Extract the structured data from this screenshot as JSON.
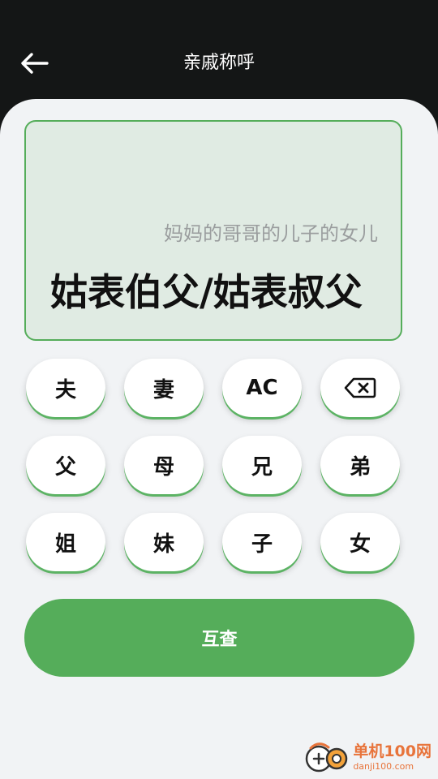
{
  "header": {
    "title": "亲戚称呼",
    "back_icon": "arrow-left-icon"
  },
  "display": {
    "expression": "妈妈的哥哥的儿子的女儿",
    "result": "姑表伯父/姑表叔父"
  },
  "keypad": {
    "rows": [
      [
        "夫",
        "妻",
        "AC",
        "backspace"
      ],
      [
        "父",
        "母",
        "兄",
        "弟"
      ],
      [
        "姐",
        "妹",
        "子",
        "女"
      ]
    ],
    "k_husband": "夫",
    "k_wife": "妻",
    "k_clear": "AC",
    "k_father": "父",
    "k_mother": "母",
    "k_elder_brother": "兄",
    "k_younger_brother": "弟",
    "k_elder_sister": "姐",
    "k_younger_sister": "妹",
    "k_son": "子",
    "k_daughter": "女"
  },
  "actions": {
    "query_label": "互查"
  },
  "watermark": {
    "main": "单机100网",
    "url": "danji100.com"
  },
  "colors": {
    "accent": "#55ad5a",
    "header_bg": "#141616",
    "panel_bg": "#f1f3f5",
    "display_bg": "#e0ebe3"
  }
}
